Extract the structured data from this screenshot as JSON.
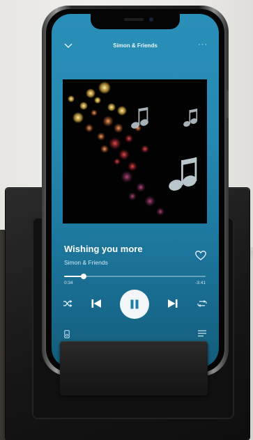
{
  "app": {
    "playlist_title": "Simon & Friends",
    "more_label": "···"
  },
  "track": {
    "title": "Wishing you more",
    "artist": "Simon & Friends",
    "elapsed": "0:34",
    "remaining": "-3:41",
    "progress": 0.14
  },
  "icons": {
    "collapse": "chevron-down-icon",
    "menu": "more-icon",
    "like": "heart-icon",
    "shuffle": "shuffle-icon",
    "previous": "skip-previous-icon",
    "play_pause": "pause-icon",
    "next": "skip-next-icon",
    "repeat": "repeat-icon",
    "device": "speaker-icon",
    "queue": "queue-icon"
  },
  "colors": {
    "accent": "#2a8fb8",
    "foreground": "#ffffff"
  }
}
